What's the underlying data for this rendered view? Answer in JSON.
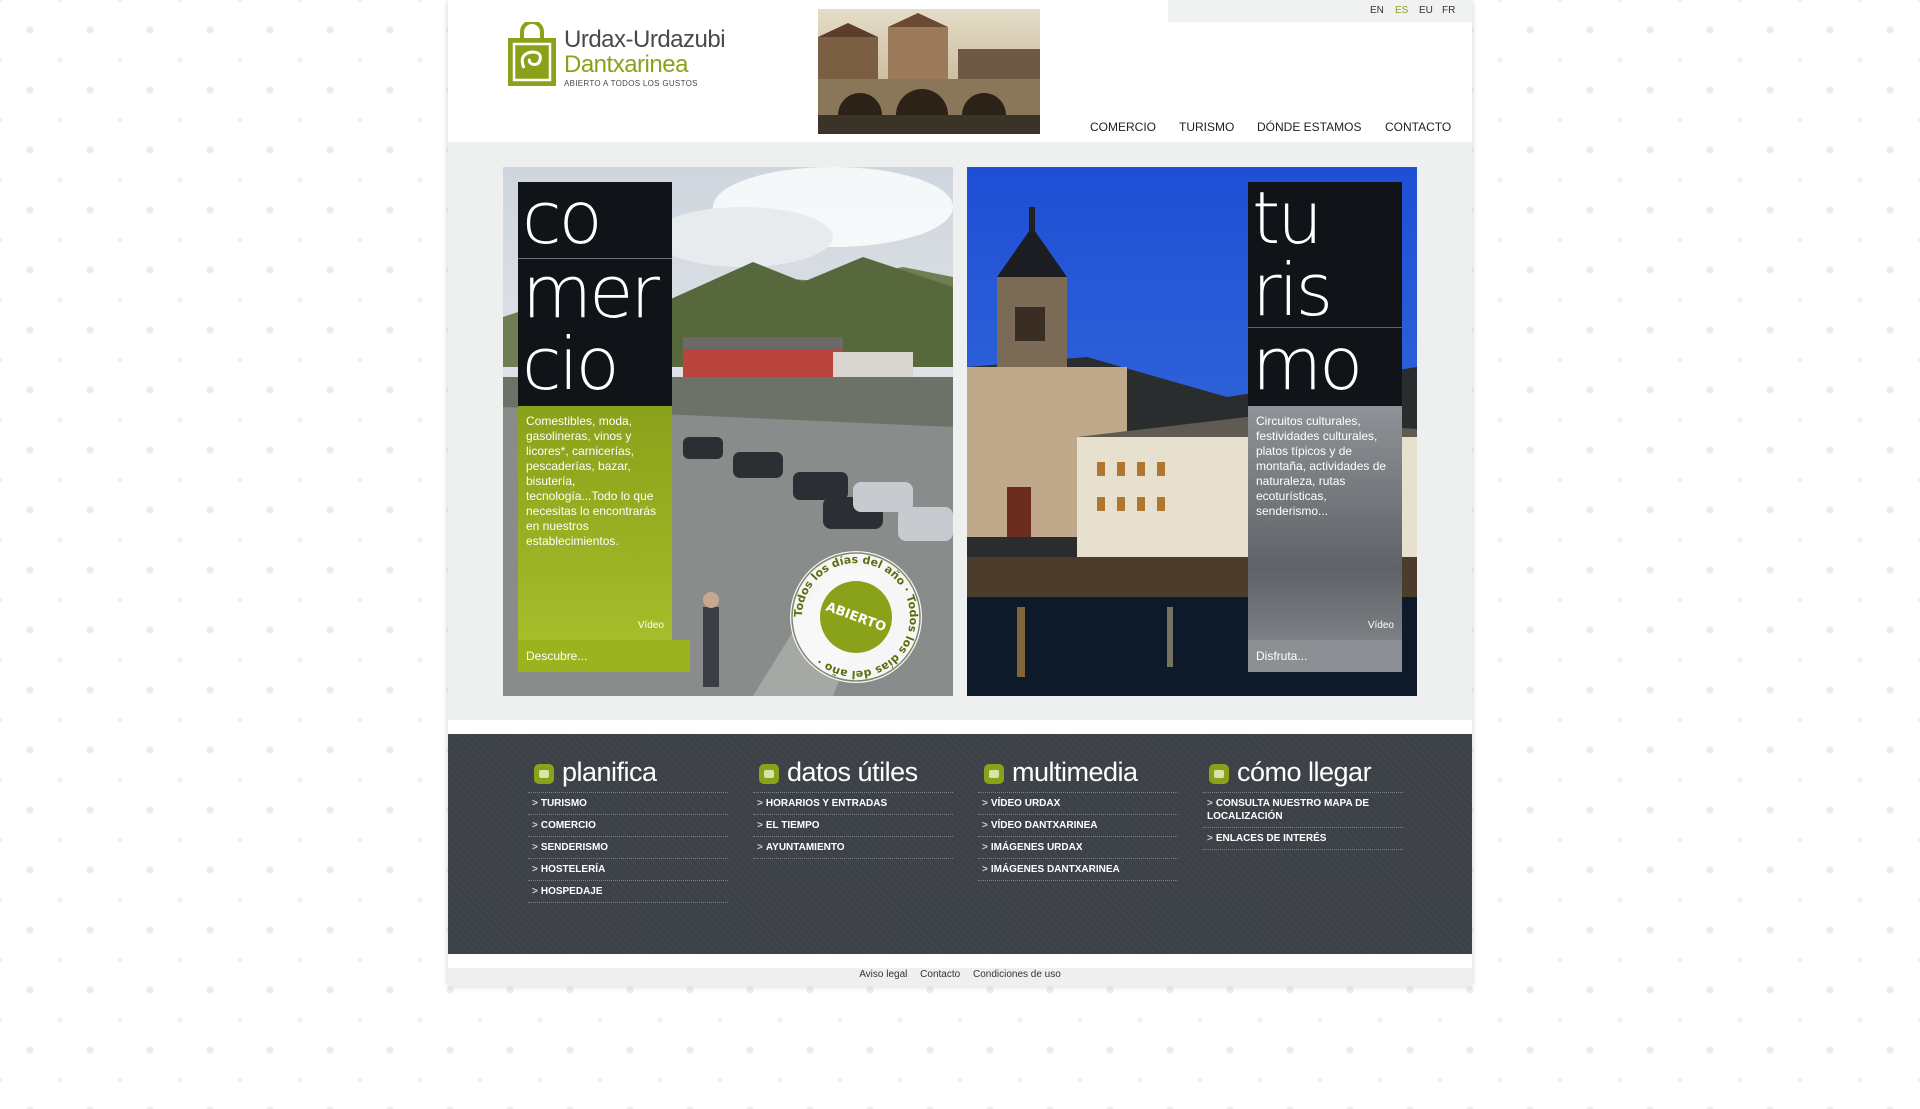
{
  "logo": {
    "line1": "Urdax-Urdazubi",
    "line2": "Dantxarinea",
    "tagline": "ABIERTO A TODOS LOS GUSTOS"
  },
  "languages": [
    {
      "label": "EN",
      "active": false
    },
    {
      "label": "ES",
      "active": true
    },
    {
      "label": "EU",
      "active": false
    },
    {
      "label": "FR",
      "active": false
    }
  ],
  "nav": [
    "COMERCIO",
    "TURISMO",
    "DÓNDE ESTAMOS",
    "CONTACTO"
  ],
  "comercio": {
    "title_syllables": [
      "co",
      "mer",
      "cio"
    ],
    "description": "Comestibles, moda, gasolineras, vinos y licores*, carnicerías, pescaderías, bazar, bisutería, tecnología...Todo lo que necesitas lo encontrarás en nuestros establecimientos.",
    "video_label": "Vídeo",
    "cta": "Descubre...",
    "badge": {
      "center": "ABIERTO",
      "ring": "Todos los días del año · Todos los días del año ·"
    },
    "accent": "#8aa11a"
  },
  "turismo": {
    "title_syllables": [
      "tu",
      "ris",
      "mo"
    ],
    "description": "Circuitos culturales, festividades culturales, platos típicos y de montaña, actividades de naturaleza, rutas ecoturísticas, senderismo...",
    "video_label": "Vídeo",
    "cta": "Disfruta...",
    "accent": "#8e9296"
  },
  "columns": [
    {
      "title": "planifica",
      "items": [
        "TURISMO",
        "COMERCIO",
        "SENDERISMO",
        "HOSTELERÍA",
        "HOSPEDAJE"
      ]
    },
    {
      "title": "datos útiles",
      "items": [
        "HORARIOS Y ENTRADAS",
        "EL TIEMPO",
        "AYUNTAMIENTO"
      ]
    },
    {
      "title": "multimedia",
      "items": [
        "VÍDEO URDAX",
        "VÍDEO DANTXARINEA",
        "IMÁGENES URDAX",
        "IMÁGENES DANTXARINEA"
      ]
    },
    {
      "title": "cómo llegar",
      "items": [
        "CONSULTA NUESTRO MAPA DE LOCALIZACIÓN",
        "ENLACES DE INTERÉS"
      ]
    }
  ],
  "footer": [
    "Aviso legal",
    "Contacto",
    "Condiciones de uso"
  ],
  "colors": {
    "brand_green": "#8aa11a",
    "dark_band": "#3c4147",
    "light_band": "#eef0ef"
  }
}
